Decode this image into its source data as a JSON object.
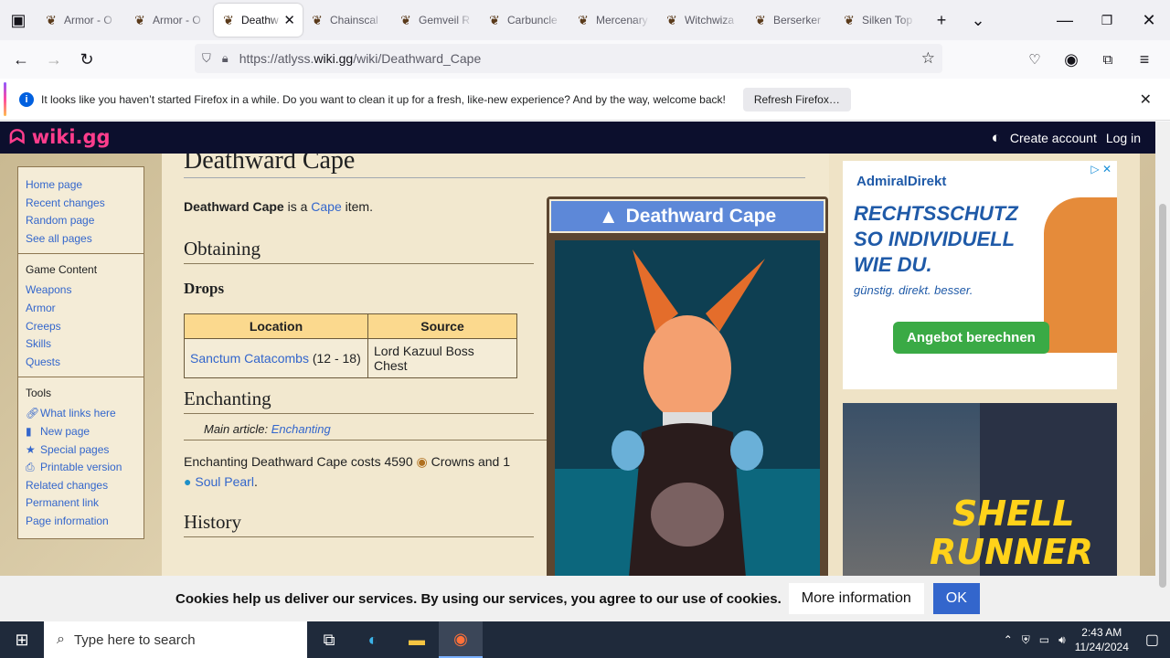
{
  "browser": {
    "tabs": [
      {
        "title": "Armor - O",
        "active": false
      },
      {
        "title": "Armor - O",
        "active": false
      },
      {
        "title": "Deathw",
        "active": true
      },
      {
        "title": "Chainscal",
        "active": false
      },
      {
        "title": "Gemveil R",
        "active": false
      },
      {
        "title": "Carbuncle",
        "active": false
      },
      {
        "title": "Mercenary",
        "active": false
      },
      {
        "title": "Witchwiza",
        "active": false
      },
      {
        "title": "Berserker",
        "active": false
      },
      {
        "title": "Silken Top",
        "active": false
      }
    ],
    "url_prefix": "https://atlyss.",
    "url_domain": "wiki.gg",
    "url_path": "/wiki/Deathward_Cape",
    "notification": "It looks like you haven’t started Firefox in a while. Do you want to clean it up for a fresh, like-new experience? And by the way, welcome back!",
    "refresh_button": "Refresh Firefox…"
  },
  "wiki": {
    "logo": "wiki.gg",
    "create_account": "Create account",
    "login": "Log in",
    "sidebar": {
      "nav": [
        "Home page",
        "Recent changes",
        "Random page",
        "See all pages"
      ],
      "game_title": "Game Content",
      "game": [
        "Weapons",
        "Armor",
        "Creeps",
        "Skills",
        "Quests"
      ],
      "tools_title": "Tools",
      "tools": [
        {
          "label": "What links here",
          "icon": "link-icon"
        },
        {
          "label": "New page",
          "icon": "file-icon"
        },
        {
          "label": "Special pages",
          "icon": "star-icon"
        },
        {
          "label": "Printable version",
          "icon": "printer-icon"
        },
        {
          "label": "Related changes"
        },
        {
          "label": "Permanent link"
        },
        {
          "label": "Page information"
        }
      ]
    },
    "page": {
      "title": "Deathward Cape",
      "intro_bold": "Deathward Cape",
      "intro_mid": " is a ",
      "intro_link": "Cape",
      "intro_end": " item.",
      "h_obtaining": "Obtaining",
      "h_drops": "Drops",
      "table": {
        "headers": [
          "Location",
          "Source"
        ],
        "row": {
          "location_link": "Sanctum Catacombs",
          "location_levels": " (12 - 18)",
          "source": "Lord Kazuul Boss Chest"
        }
      },
      "h_enchanting": "Enchanting",
      "main_article_label": "Main article: ",
      "main_article_link": "Enchanting",
      "ench_text": "Enchanting Deathward Cape costs 4590",
      "ench_crowns": " Crowns and 1",
      "ench_link": "Soul Pearl",
      "ench_end": ".",
      "h_history": "History",
      "infobox_title": "Deathward Cape"
    },
    "ads": {
      "ad1_brand": "AdmiralDirekt",
      "ad1_line1": "RECHTSSCHUTZ",
      "ad1_line2": "SO INDIVIDUELL",
      "ad1_line3": "WIE DU.",
      "ad1_tagline": "günstig. direkt. besser.",
      "ad1_button": "Angebot berechnen",
      "ad2_line1": "SHELL",
      "ad2_line2": "RUNNER"
    },
    "cookie_text": "Cookies help us deliver our services. By using our services, you agree to our use of cookies.",
    "cookie_more": "More information",
    "cookie_ok": "OK"
  },
  "taskbar": {
    "search_placeholder": "Type here to search",
    "time": "2:43 AM",
    "date": "11/24/2024"
  }
}
